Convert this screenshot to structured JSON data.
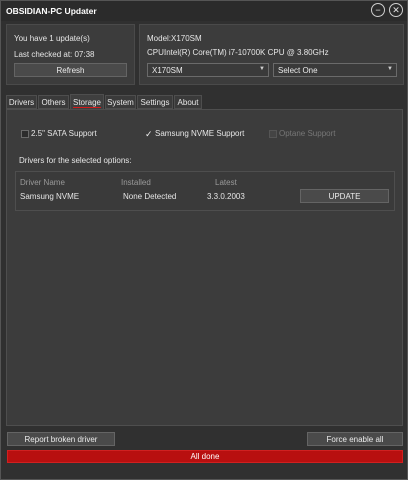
{
  "window": {
    "title": "OBSIDIAN-PC Updater",
    "minimize_glyph": "−",
    "close_glyph": "✕"
  },
  "update_panel": {
    "updates_text": "You have 1 update(s)",
    "last_checked": "Last checked at: 07:38",
    "refresh_label": "Refresh"
  },
  "system_panel": {
    "model_label": "Model:",
    "model_value": "X170SM",
    "cpu_label": "CPU:",
    "cpu_value": "Intel(R) Core(TM) i7-10700K CPU @ 3.80GHz",
    "model_select": "X170SM",
    "option_select": "Select One"
  },
  "tabs": [
    {
      "label": "Drivers",
      "active": false
    },
    {
      "label": "Others",
      "active": false
    },
    {
      "label": "Storage",
      "active": true
    },
    {
      "label": "System",
      "active": false
    },
    {
      "label": "Settings",
      "active": false
    },
    {
      "label": "About",
      "active": false
    }
  ],
  "storage": {
    "options": [
      {
        "label": "2.5\" SATA Support",
        "checked": false,
        "enabled": true
      },
      {
        "label": "Samsung NVME Support",
        "checked": true,
        "enabled": true
      },
      {
        "label": "Optane Support",
        "checked": false,
        "enabled": false
      }
    ],
    "drivers_heading": "Drivers for the selected options:",
    "columns": [
      "Driver Name",
      "Installed",
      "Latest"
    ],
    "rows": [
      {
        "name": "Samsung NVME",
        "installed": "None Detected",
        "latest": "3.3.0.2003",
        "action": "UPDATE"
      }
    ]
  },
  "footer": {
    "report_label": "Report broken driver",
    "force_label": "Force enable all",
    "status_text": "All done",
    "progress": 1.0
  },
  "colors": {
    "accent": "#d21a1a",
    "progress": "#b80f0f",
    "background": "#303030",
    "panel": "#3c3c3c"
  }
}
